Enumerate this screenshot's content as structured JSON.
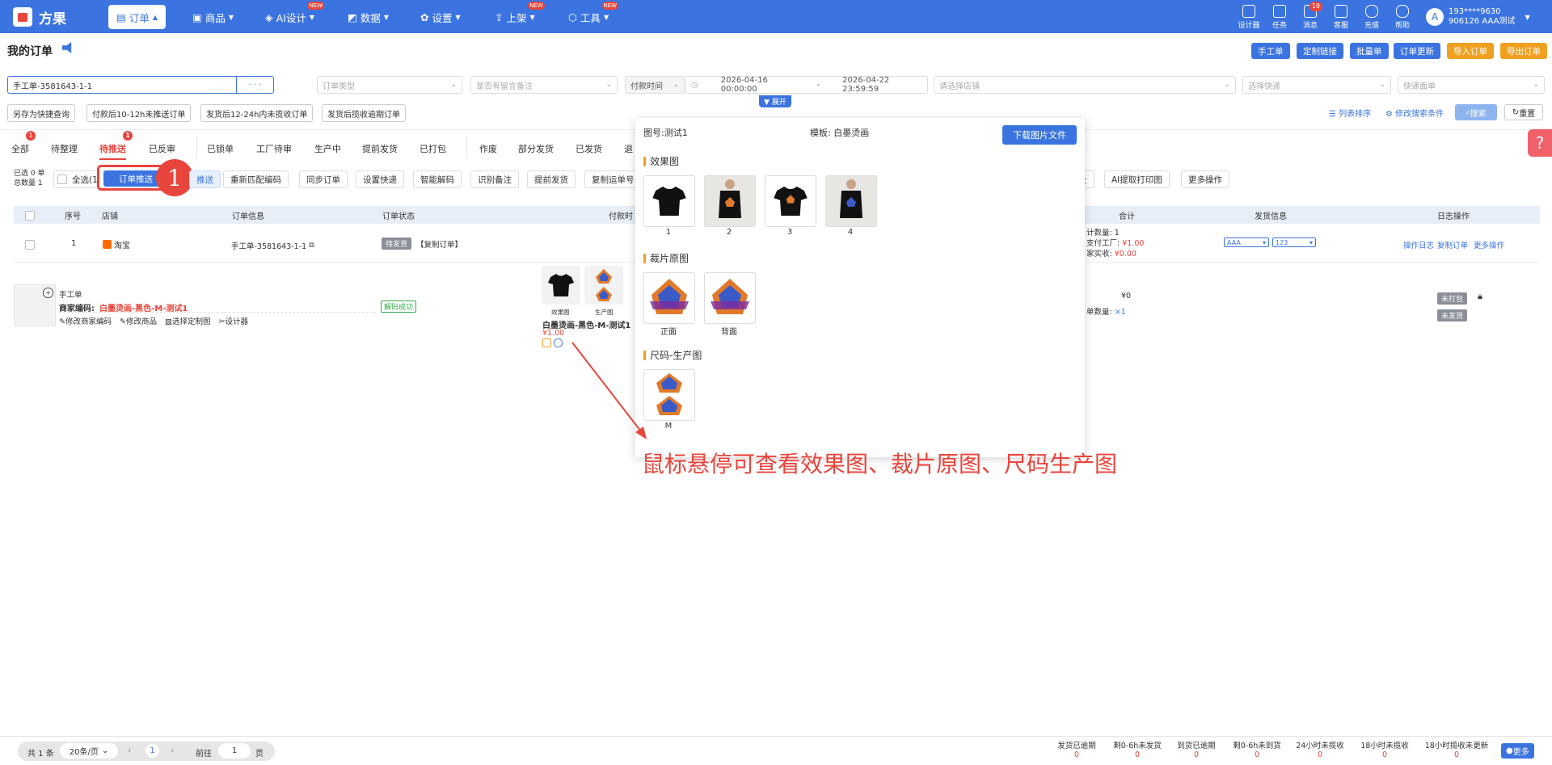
{
  "app": {
    "logo_text": "方果"
  },
  "nav": {
    "items": [
      {
        "label": "订单",
        "new": false
      },
      {
        "label": "商品",
        "new": false
      },
      {
        "label": "AI设计",
        "new": true
      },
      {
        "label": "数据",
        "new": true
      },
      {
        "label": "设置",
        "new": false
      },
      {
        "label": "上架",
        "new": true
      },
      {
        "label": "工具",
        "new": true
      }
    ],
    "new_badge": "NEW",
    "tools": [
      "设计器",
      "任务",
      "消息",
      "客服",
      "充值",
      "帮助"
    ],
    "message_count": "19",
    "user_line1": "193****9630",
    "user_line2": "906126  AAA测试"
  },
  "page": {
    "title": "我的订单",
    "buttons": [
      "手工单",
      "定制链接",
      "批量单",
      "订单更新",
      "导入订单",
      "导出订单"
    ]
  },
  "filters": {
    "search_value": "手工单-3581643-1-1",
    "more": "· · ·",
    "order_type": "订单类型",
    "remark": "是否有留言备注",
    "time_type": "付款时间",
    "date_start": "2026-04-16 00:00:00",
    "date_sep": "-",
    "date_end": "2026-04-22 23:59:59",
    "shop": "请选择店铺",
    "express": "选择快递",
    "express_sheet": "快递面单",
    "expand": "展开",
    "quick": [
      "另存为快捷查询",
      "付款后10-12h未推送订单",
      "发货后12-24h内未揽收订单",
      "发货后揽收逾期订单"
    ],
    "list_sort": "列表排序",
    "edit_cond": "修改搜索条件",
    "search": "搜索",
    "reset": "重置"
  },
  "tabs": {
    "group1": [
      {
        "label": "全部",
        "badge": "1"
      },
      {
        "label": "待整理",
        "badge": ""
      },
      {
        "label": "待推送",
        "badge": "1",
        "active": true
      },
      {
        "label": "已反审",
        "badge": ""
      }
    ],
    "group2": [
      "已锁单",
      "工厂待审",
      "生产中",
      "提前发货",
      "已打包"
    ],
    "group3": [
      "作废",
      "部分发货",
      "已发货",
      "退"
    ]
  },
  "actions": {
    "selected_line1": "已选 0 单",
    "selected_line2": "总数量 1",
    "select_all": "全选(1",
    "push": "订单推送",
    "marker": "1",
    "push2": "推送",
    "buttons": [
      "重新匹配编码",
      "同步订单",
      "设置快递",
      "智能解码",
      "识别备注",
      "提前发货",
      "复制运单号"
    ],
    "right_buttons": [
      "址",
      "AI提取打印图",
      "更多操作"
    ]
  },
  "table": {
    "headers": [
      "序号",
      "店铺",
      "订单信息",
      "订单状态",
      "付款时",
      "合计",
      "发货信息",
      "日志操作"
    ],
    "row": {
      "index": "1",
      "shop": "淘宝",
      "order_no": "手工单-3581643-1-1",
      "status": "待发货",
      "copy_tag": "【复制订单】",
      "total_qty": "计数量: 1",
      "factory_pay": "支付工厂: ",
      "factory_amt": "¥1.00",
      "merchant_recv": "家实收: ",
      "merchant_amt": "¥0.00",
      "ship_sel1": "AAA",
      "ship_sel2": "123",
      "ops": [
        "操作日志",
        "复制订单",
        "更多操作"
      ]
    },
    "item": {
      "type": "手工单",
      "merchant_code_label": "商家编码:",
      "merchant_code": "白墨烫画-黑色-M-测试1",
      "decode": "解码成功",
      "edit_links": [
        "修改商家编码",
        "修改商品",
        "选择定制图",
        "设计器"
      ],
      "img_labels": [
        "效果图",
        "生产图"
      ],
      "name": "白墨烫画-黑色-M-测试1",
      "price": "¥1.00",
      "amount": "¥0",
      "qty_label": "单数量: ",
      "qty": "×1",
      "tags": [
        "未打包",
        "未发货"
      ]
    }
  },
  "popup": {
    "img_no": "图号:测试1",
    "template": "模板: 白墨烫画",
    "download": "下载图片文件",
    "effect_title": "效果图",
    "effect_labels": [
      "1",
      "2",
      "3",
      "4"
    ],
    "cut_title": "裁片原图",
    "cut_labels": [
      "正面",
      "背面"
    ],
    "size_title": "尺码-生产图",
    "size_labels": [
      "M"
    ]
  },
  "annotation": {
    "text": "鼠标悬停可查看效果图、裁片原图、尺码生产图",
    "color": "#e8453c"
  },
  "footer": {
    "total": "共 1 条",
    "page_size": "20条/页",
    "current": "1",
    "goto": "前往",
    "goto_value": "1",
    "page_unit": "页",
    "stats": [
      {
        "label": "发货已逾期",
        "value": "0"
      },
      {
        "label": "剩0-6h未发货",
        "value": "0"
      },
      {
        "label": "到货已逾期",
        "value": "0"
      },
      {
        "label": "剩0-6h未到货",
        "value": "0"
      },
      {
        "label": "24小时未揽收",
        "value": "0"
      },
      {
        "label": "18小时未揽收",
        "value": "0"
      },
      {
        "label": "18小时揽收未更新",
        "value": "0"
      }
    ],
    "more": "更多"
  },
  "colors": {
    "primary": "#3b74e0",
    "orange": "#f0a020",
    "red": "#e8453c"
  }
}
